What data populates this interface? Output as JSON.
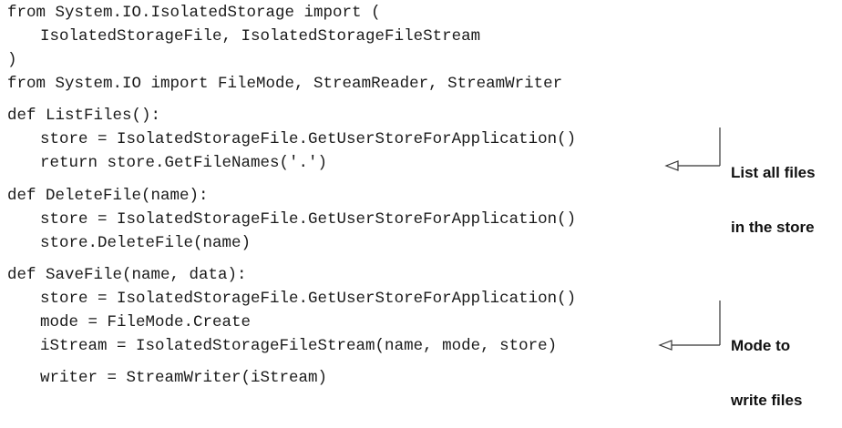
{
  "code_lines": [
    "from System.IO.IsolatedStorage import (",
    "IsolatedStorageFile, IsolatedStorageFileStream",
    ")",
    "from System.IO import FileMode, StreamReader, StreamWriter",
    "def ListFiles():",
    "store = IsolatedStorageFile.GetUserStoreForApplication()",
    "return store.GetFileNames('.')",
    "def DeleteFile(name):",
    "store = IsolatedStorageFile.GetUserStoreForApplication()",
    "store.DeleteFile(name)",
    "def SaveFile(name, data):",
    "store = IsolatedStorageFile.GetUserStoreForApplication()",
    "mode = FileMode.Create",
    "iStream = IsolatedStorageFileStream(name, mode, store)",
    "writer = StreamWriter(iStream)"
  ],
  "annotations": {
    "list_files": {
      "line1": "List all files",
      "line2": "in the store"
    },
    "mode": {
      "line1": "Mode to",
      "line2": "write files"
    }
  },
  "colors": {
    "text": "#1a1a1a",
    "callout": "#333333"
  }
}
